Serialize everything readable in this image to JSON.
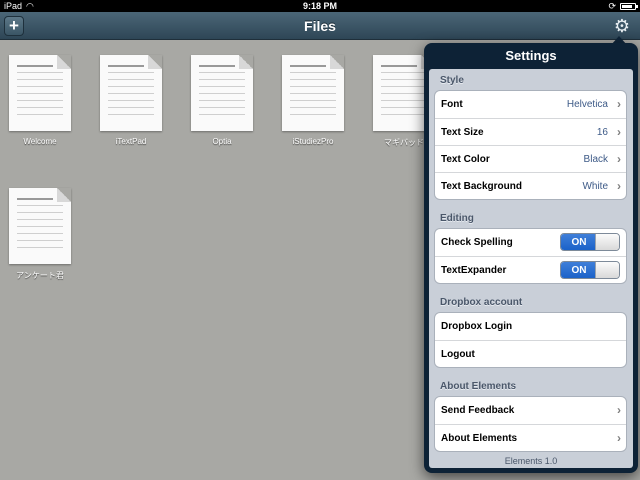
{
  "status_bar": {
    "device": "iPad",
    "time": "9:18 PM",
    "battery_level": 0.85
  },
  "navbar": {
    "title": "Files",
    "add_label": "+",
    "settings_icon": "gear-icon"
  },
  "files": [
    {
      "name": "Welcome"
    },
    {
      "name": "iTextPad"
    },
    {
      "name": "Optia"
    },
    {
      "name": "iStudiezPro"
    },
    {
      "name": "マギバッド"
    },
    {
      "name": "アンケート君"
    }
  ],
  "settings": {
    "title": "Settings",
    "sections": [
      {
        "title": "Style",
        "rows": [
          {
            "label": "Font",
            "value": "Helvetica",
            "type": "disclosure"
          },
          {
            "label": "Text Size",
            "value": "16",
            "type": "disclosure"
          },
          {
            "label": "Text Color",
            "value": "Black",
            "type": "disclosure"
          },
          {
            "label": "Text Background",
            "value": "White",
            "type": "disclosure"
          }
        ]
      },
      {
        "title": "Editing",
        "rows": [
          {
            "label": "Check Spelling",
            "value": "ON",
            "type": "toggle"
          },
          {
            "label": "TextExpander",
            "value": "ON",
            "type": "toggle"
          }
        ]
      },
      {
        "title": "Dropbox account",
        "rows": [
          {
            "label": "Dropbox Login",
            "type": "plain"
          },
          {
            "label": "Logout",
            "type": "plain"
          }
        ]
      },
      {
        "title": "About Elements",
        "rows": [
          {
            "label": "Send Feedback",
            "type": "disclosure"
          },
          {
            "label": "About Elements",
            "type": "disclosure"
          }
        ]
      }
    ],
    "footer": "Elements 1.0"
  },
  "colors": {
    "navbar": "#3b5667",
    "background": "#a8a8a4",
    "value_text": "#3d5a87",
    "toggle_on": "#1b62c9"
  }
}
